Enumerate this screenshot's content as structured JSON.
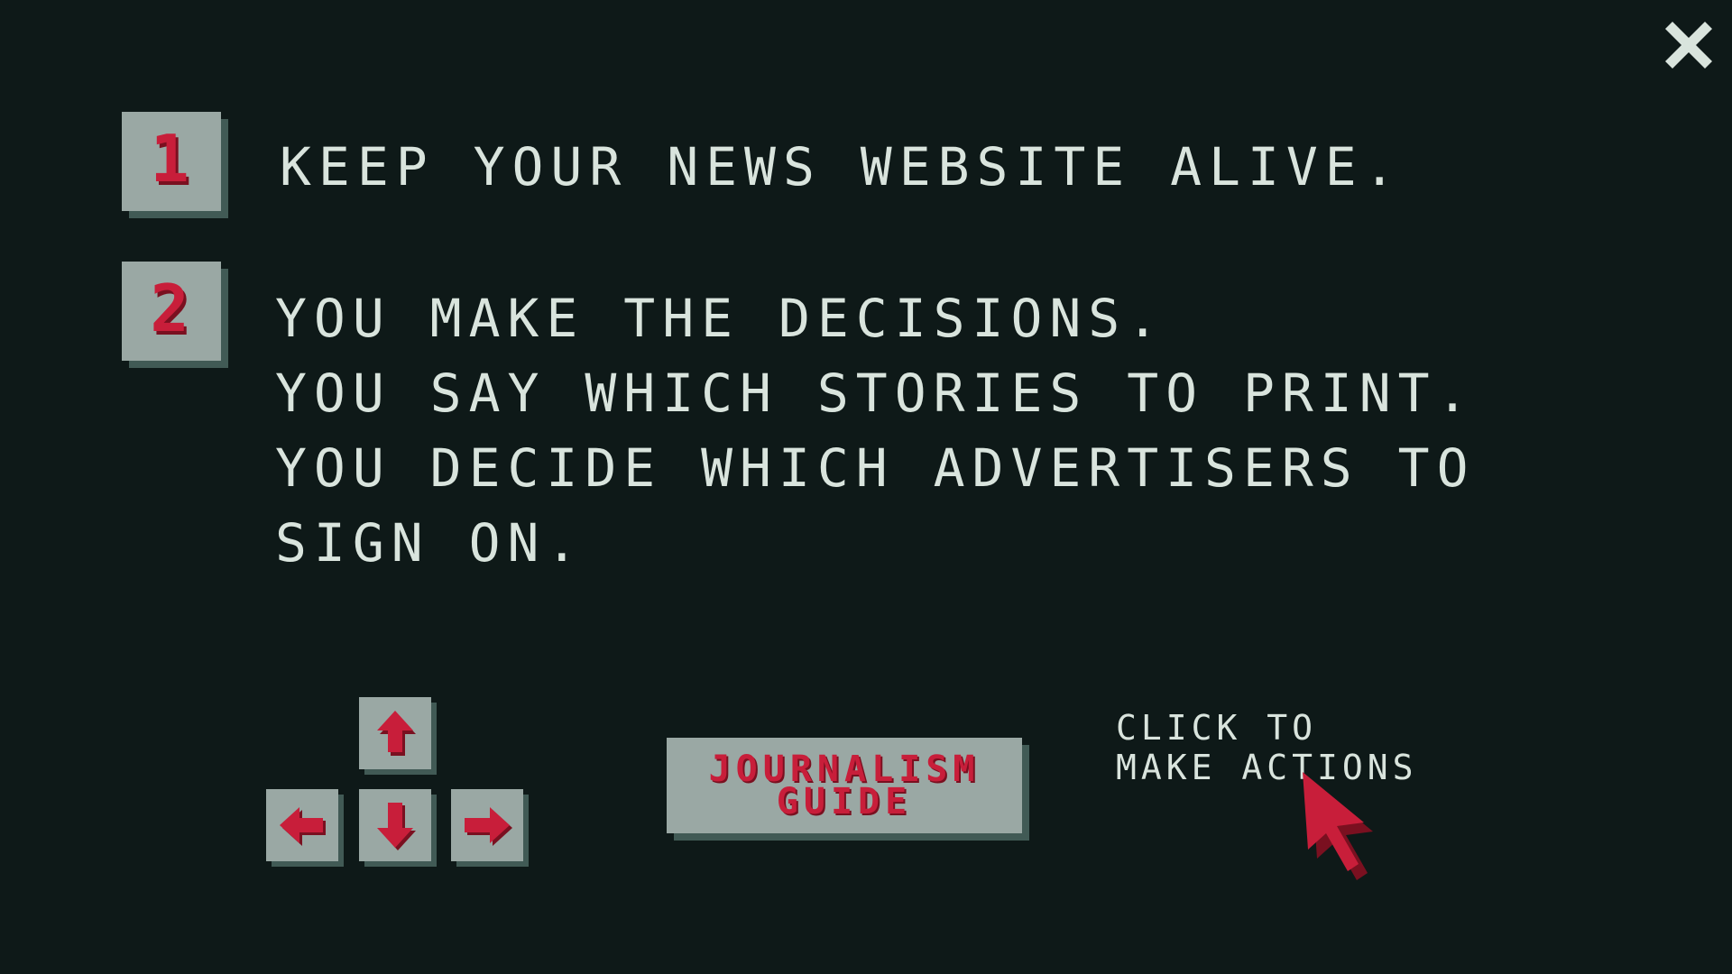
{
  "close": {
    "icon": "close-icon"
  },
  "steps": [
    {
      "number": "1",
      "lines": [
        "KEEP YOUR NEWS WEBSITE ALIVE."
      ]
    },
    {
      "number": "2",
      "lines": [
        "YOU MAKE THE DECISIONS.",
        "YOU SAY WHICH STORIES TO PRINT.",
        "YOU DECIDE WHICH ADVERTISERS TO",
        "SIGN ON."
      ]
    }
  ],
  "controls": {
    "arrow_keys": [
      "arrow-up-icon",
      "arrow-left-icon",
      "arrow-down-icon",
      "arrow-right-icon"
    ],
    "guide_button": {
      "line1": "JOURNALISM",
      "line2": "GUIDE"
    },
    "click_hint": {
      "line1": "CLICK TO",
      "line2": "MAKE ACTIONS"
    },
    "cursor_icon": "mouse-pointer-icon"
  },
  "colors": {
    "background": "#0e1918",
    "key_face": "#9aa8a4",
    "key_shadow": "#415a55",
    "accent_red": "#c81e3a",
    "text": "#d9e4dd"
  }
}
